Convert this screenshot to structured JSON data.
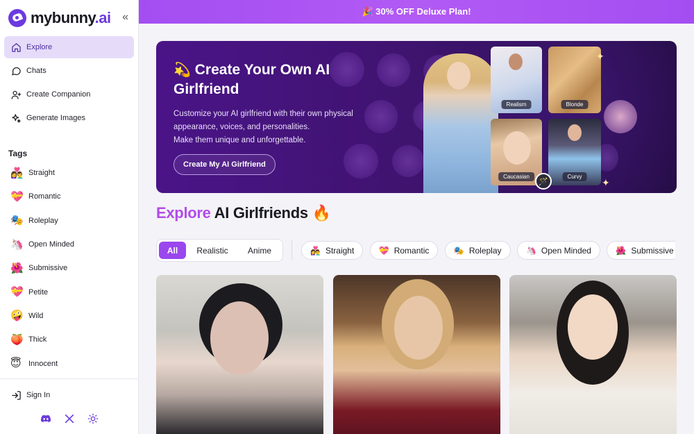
{
  "brand": {
    "name_main": "mybunny",
    "name_suffix": ".ai",
    "accent": "#6b3ae0",
    "promo_color": "#a44ef2"
  },
  "sidebar": {
    "collapse_label": "«",
    "nav": [
      {
        "label": "Explore",
        "icon": "home-icon",
        "active": true
      },
      {
        "label": "Chats",
        "icon": "chat-bubble-icon"
      },
      {
        "label": "Create Companion",
        "icon": "add-user-icon"
      },
      {
        "label": "Generate Images",
        "icon": "sparkles-icon"
      }
    ],
    "tags_title": "Tags",
    "tags": [
      {
        "label": "Straight",
        "emoji": "👩‍❤️‍👨"
      },
      {
        "label": "Romantic",
        "emoji": "💝"
      },
      {
        "label": "Roleplay",
        "emoji": "🎭"
      },
      {
        "label": "Open Minded",
        "emoji": "🦄"
      },
      {
        "label": "Submissive",
        "emoji": "🌺"
      },
      {
        "label": "Petite",
        "emoji": "💝"
      },
      {
        "label": "Wild",
        "emoji": "🤪"
      },
      {
        "label": "Thick",
        "emoji": "🍑"
      },
      {
        "label": "Innocent",
        "emoji": "😇"
      }
    ],
    "sign_in": "Sign In",
    "socials": [
      "discord-icon",
      "x-icon",
      "theme-toggle-icon"
    ]
  },
  "promo": {
    "text": "🎉 30% OFF Deluxe Plan!"
  },
  "hero": {
    "title_emoji": "💫",
    "title": "Create Your Own AI Girlfriend",
    "desc_lines": [
      "Customize your AI girlfriend with their own physical",
      "appearance, voices, and personalities.",
      "Make them unique and unforgettable."
    ],
    "button": "Create My AI Girlfriend",
    "tiles": [
      "Realism",
      "Blonde",
      "Caucasian",
      "Curvy"
    ],
    "wand": "🪄",
    "sparkle": "✦"
  },
  "explore": {
    "title_highlight": "Explore",
    "title_rest": " AI Girlfriends ",
    "title_emoji": "🔥",
    "segments": [
      "All",
      "Realistic",
      "Anime"
    ],
    "chips": [
      {
        "label": "Straight",
        "emoji": "👩‍❤️‍👨"
      },
      {
        "label": "Romantic",
        "emoji": "💝"
      },
      {
        "label": "Roleplay",
        "emoji": "🎭"
      },
      {
        "label": "Open Minded",
        "emoji": "🦄"
      },
      {
        "label": "Submissive",
        "emoji": "🌺"
      }
    ]
  }
}
